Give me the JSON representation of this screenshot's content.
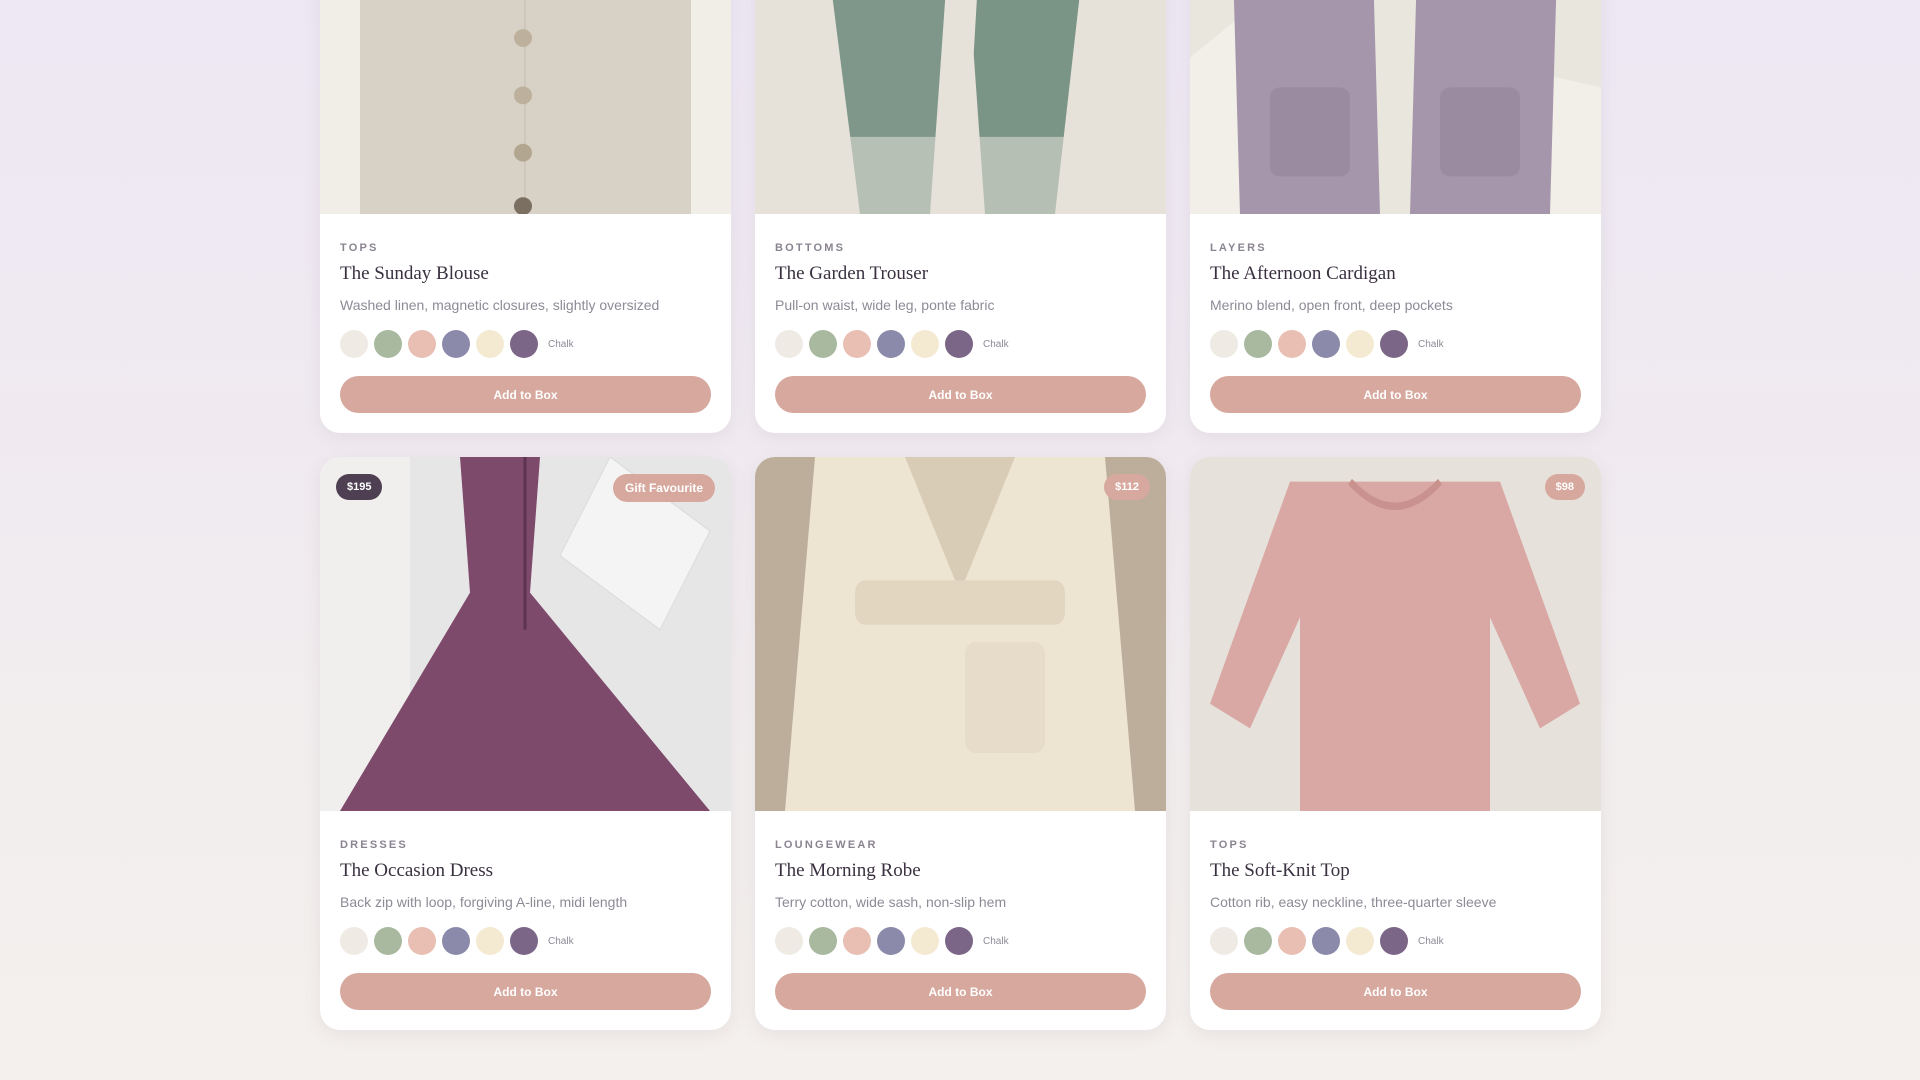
{
  "swatch_colors": [
    "#efebe4",
    "#a8b9a0",
    "#e8bfb2",
    "#8b8aab",
    "#f3ead1",
    "#7c6688"
  ],
  "swatch_label": "Chalk",
  "button_label": "Add to Box",
  "products": [
    {
      "category": "TOPS",
      "title": "The Sunday Blouse",
      "desc": "Washed linen, magnetic closures, slightly oversized"
    },
    {
      "category": "BOTTOMS",
      "title": "The Garden Trouser",
      "desc": "Pull-on waist, wide leg, ponte fabric"
    },
    {
      "category": "LAYERS",
      "title": "The Afternoon Cardigan",
      "desc": "Merino blend, open front, deep pockets"
    },
    {
      "category": "DRESSES",
      "title": "The Occasion Dress",
      "desc": "Back zip with loop, forgiving A-line, midi length",
      "price": "$195",
      "badge": "Gift Favourite"
    },
    {
      "category": "LOUNGEWEAR",
      "title": "The Morning Robe",
      "desc": "Terry cotton, wide sash, non-slip hem",
      "price": "$112"
    },
    {
      "category": "TOPS",
      "title": "The Soft-Knit Top",
      "desc": "Cotton rib, easy neckline, three-quarter sleeve",
      "price": "$98"
    }
  ]
}
